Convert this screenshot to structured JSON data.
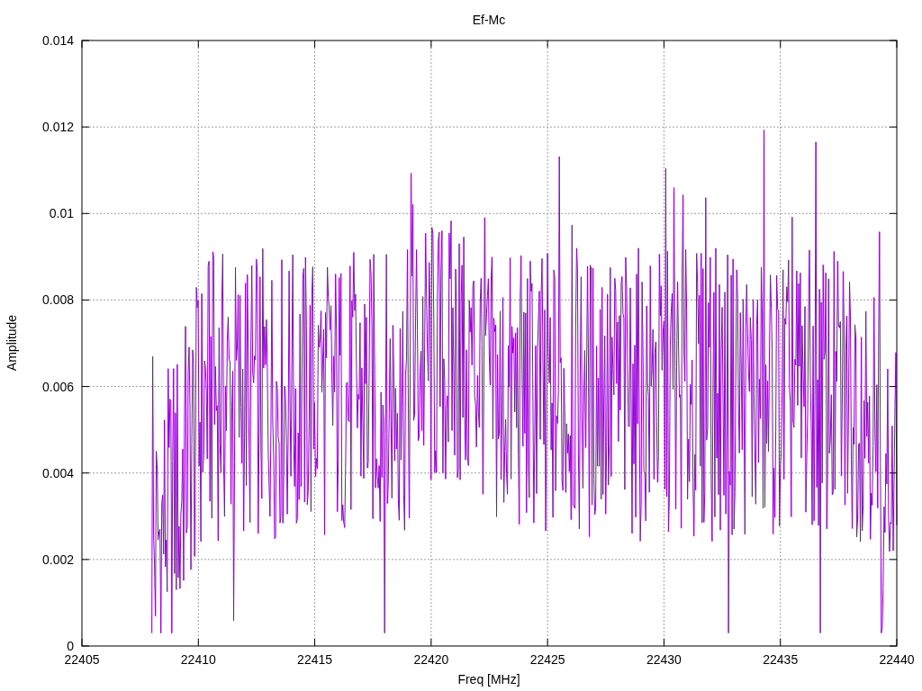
{
  "plot": {
    "title": "Ef-Mc",
    "xlabel": "Freq [MHz]",
    "ylabel": "Amplitude",
    "xticks": [
      "22405",
      "22410",
      "22415",
      "22420",
      "22425",
      "22430",
      "22435",
      "22440"
    ],
    "yticks": [
      "0.014",
      "0.012",
      "0.01",
      "0.008",
      "0.006",
      "0.004",
      "0.002",
      "0"
    ]
  }
}
